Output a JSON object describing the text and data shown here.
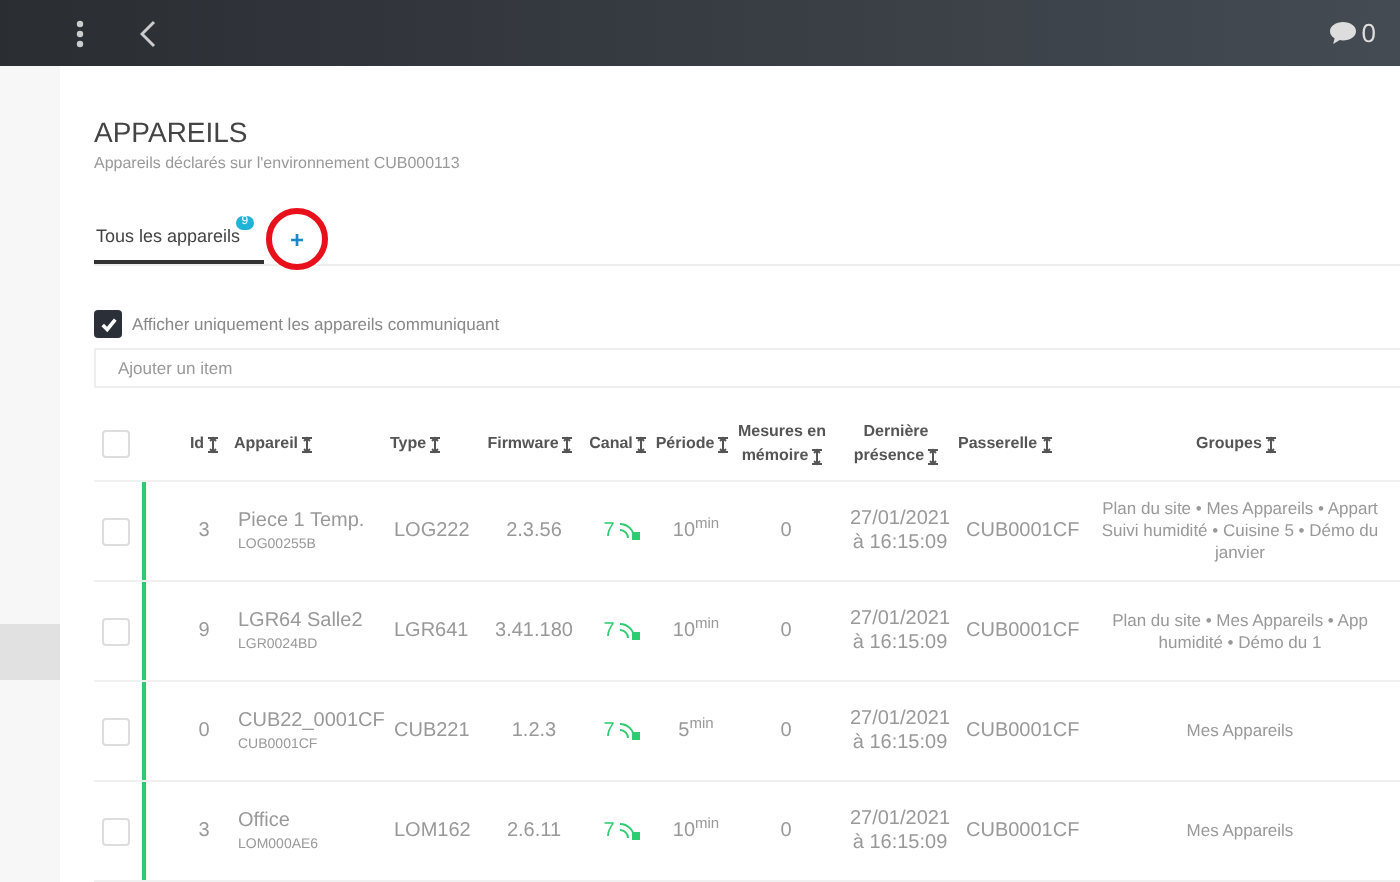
{
  "topbar": {
    "comment_count": "0"
  },
  "page": {
    "title": "APPAREILS",
    "subtitle": "Appareils déclarés sur l'environnement CUB000113"
  },
  "tabs": [
    {
      "label": "Tous les appareils",
      "badge": "9",
      "selected": true
    },
    {
      "label": "+",
      "selected": false,
      "highlighted": true
    }
  ],
  "filter": {
    "label": "Afficher uniquement les appareils communiquant",
    "checked": true
  },
  "add_field": {
    "placeholder": "Ajouter un item"
  },
  "table": {
    "select_all": {
      "checked": false
    },
    "columns": [
      {
        "label": "Id",
        "sortable": true
      },
      {
        "label": "Appareil",
        "sortable": true
      },
      {
        "label": "Type",
        "sortable": true
      },
      {
        "label": "Firmware",
        "sortable": true
      },
      {
        "label": "Canal",
        "sortable": true
      },
      {
        "label": "Période",
        "sortable": true
      },
      {
        "label": "Mesures en mémoire",
        "sortable": true
      },
      {
        "label": "Dernière présence",
        "sortable": true
      },
      {
        "label": "Passerelle",
        "sortable": true
      },
      {
        "label": "Groupes",
        "sortable": true
      }
    ],
    "rows": [
      {
        "checked": false,
        "online": true,
        "id": "3",
        "name": "Piece 1 Temp.",
        "serial": "LOG00255B",
        "type": "LOG222",
        "firmware": "2.3.56",
        "channel": "7",
        "period": "10$^{min}$",
        "memory": "0",
        "last_seen": [
          "27/01/2021",
          "à 16:15:09"
        ],
        "gateway": "CUB0001CF",
        "groups": [
          "Plan du site • Mes Appareils • Appart",
          "Suivi humidité • Cuisine 5 • Démo du",
          "janvier"
        ]
      },
      {
        "checked": false,
        "online": true,
        "id": "9",
        "name": "LGR64 Salle2",
        "serial": "LGR0024BD",
        "type": "LGR641",
        "firmware": "3.41.180",
        "channel": "7",
        "period": "10$^{min}$",
        "memory": "0",
        "last_seen": [
          "27/01/2021",
          "à 16:15:09"
        ],
        "gateway": "CUB0001CF",
        "groups": [
          "Plan du site • Mes Appareils • App",
          "humidité • Démo du 1"
        ]
      },
      {
        "checked": false,
        "online": true,
        "id": "0",
        "name": "CUB22_0001CF",
        "serial": "CUB0001CF",
        "type": "CUB221",
        "firmware": "1.2.3",
        "channel": "7",
        "period": "5$^{min}$",
        "memory": "0",
        "last_seen": [
          "27/01/2021",
          "à 16:15:09"
        ],
        "gateway": "CUB0001CF",
        "groups": [
          "Mes Appareils"
        ]
      },
      {
        "checked": false,
        "online": true,
        "id": "3",
        "name": "Office",
        "serial": "LOM000AE6",
        "type": "LOM162",
        "firmware": "2.6.11",
        "channel": "7",
        "period": "10$^{min}$",
        "memory": "0",
        "last_seen": [
          "27/01/2021",
          "à 16:15:09"
        ],
        "gateway": "CUB0001CF",
        "groups": [
          "Mes Appareils"
        ]
      }
    ]
  }
}
